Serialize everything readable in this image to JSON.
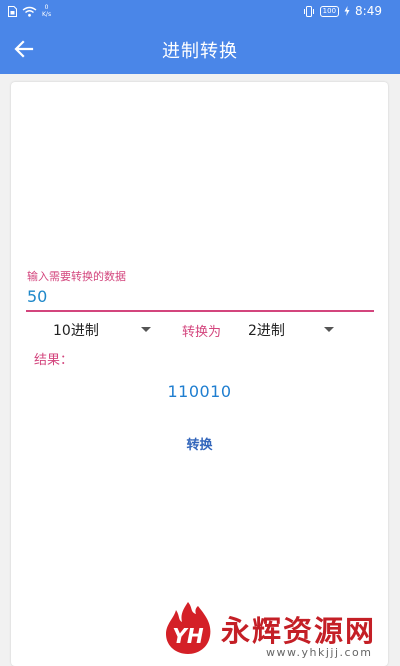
{
  "status_bar": {
    "speed_value": "0",
    "speed_unit": "K/s",
    "battery": "100",
    "time": "8:49"
  },
  "app_bar": {
    "title": "进制转换",
    "back_icon": "arrow-back-icon"
  },
  "form": {
    "input_label": "输入需要转换的数据",
    "input_value": "50",
    "from_base": "10进制",
    "convert_to_label": "转换为",
    "to_base": "2进制",
    "result_label": "结果：",
    "result_value": "110010",
    "convert_button": "转换"
  },
  "watermark": {
    "logo_text": "YH",
    "title": "永辉资源网",
    "url": "www.yhkjjj.com"
  },
  "colors": {
    "primary": "#4a86e8",
    "accent": "#d3457d",
    "result": "#1f7ed0",
    "watermark_red": "#c41f26"
  }
}
